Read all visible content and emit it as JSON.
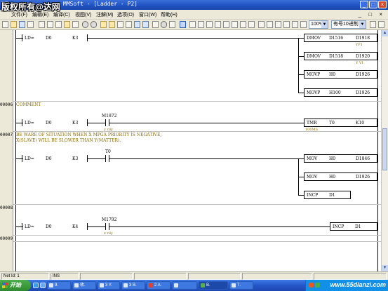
{
  "window": {
    "title": "MMSoft - [Ladder - P2]",
    "watermark": "版权所有@达网",
    "min": "_",
    "max": "□",
    "close": "×"
  },
  "menu": {
    "items": [
      "文件(F)",
      "编辑(E)",
      "编译(C)",
      "视图(V)",
      "注解(M)",
      "选项(O)",
      "窗口(W)",
      "帮助(H)"
    ],
    "right_controls": "_ □ ×"
  },
  "toolbar": {
    "zoom": "100%",
    "radix": "有号10进制"
  },
  "ladder": {
    "steps": [
      "00006",
      "00007",
      "00008",
      "00009"
    ],
    "rung1": {
      "cmp": "LD=",
      "a": "D0",
      "b": "K3",
      "outputs": [
        {
          "op": "DMOV",
          "s": "D1516",
          "d": "D1918",
          "note": "YP1"
        },
        {
          "op": "DMOV",
          "s": "D1518",
          "d": "D1920",
          "note": "Y VI"
        },
        {
          "op": "MOVP",
          "s": "H0",
          "d": "D1926",
          "note": ""
        },
        {
          "op": "MOVP",
          "s": "H100",
          "d": "D1926",
          "note": ""
        }
      ]
    },
    "rung2": {
      "comment": "COMMENT",
      "cmp": "LD=",
      "a": "D0",
      "b": "K3",
      "contact": "M1872",
      "contact_note": "y rdy",
      "output": {
        "op": "TMR",
        "s": "T0",
        "d": "K10",
        "note": "100MS"
      }
    },
    "rung3": {
      "comment_line1": "BE WARE OF SITUATION WHEN X MPGA PRIORITY IS NEGATIVE,",
      "comment_line2": "X(SLAVE) WILL BE SLOWER THAN Y(MATTER).",
      "cmp": "LD=",
      "a": "D0",
      "b": "K3",
      "contact": "T0",
      "outputs": [
        {
          "op": "MOV",
          "s": "H0",
          "d": "D1846"
        },
        {
          "op": "MOV",
          "s": "H0",
          "d": "D1926"
        },
        {
          "op": "INCP",
          "s": "D1",
          "d": ""
        }
      ]
    },
    "rung4": {
      "cmp": "LD=",
      "a": "D0",
      "b": "K4",
      "contact": "M1792",
      "contact_note": "x rdy",
      "output": {
        "op": "INCP",
        "s": "D1"
      }
    }
  },
  "statusbar": {
    "net_id": "Net Id: 1",
    "mode": "INS"
  },
  "taskbar": {
    "start": "开始",
    "tasks": [
      "9.",
      "收.",
      "3 Y.",
      "3 B.",
      "2 A.",
      "",
      "B.",
      "7."
    ],
    "site": "www.55dianzi.com"
  }
}
